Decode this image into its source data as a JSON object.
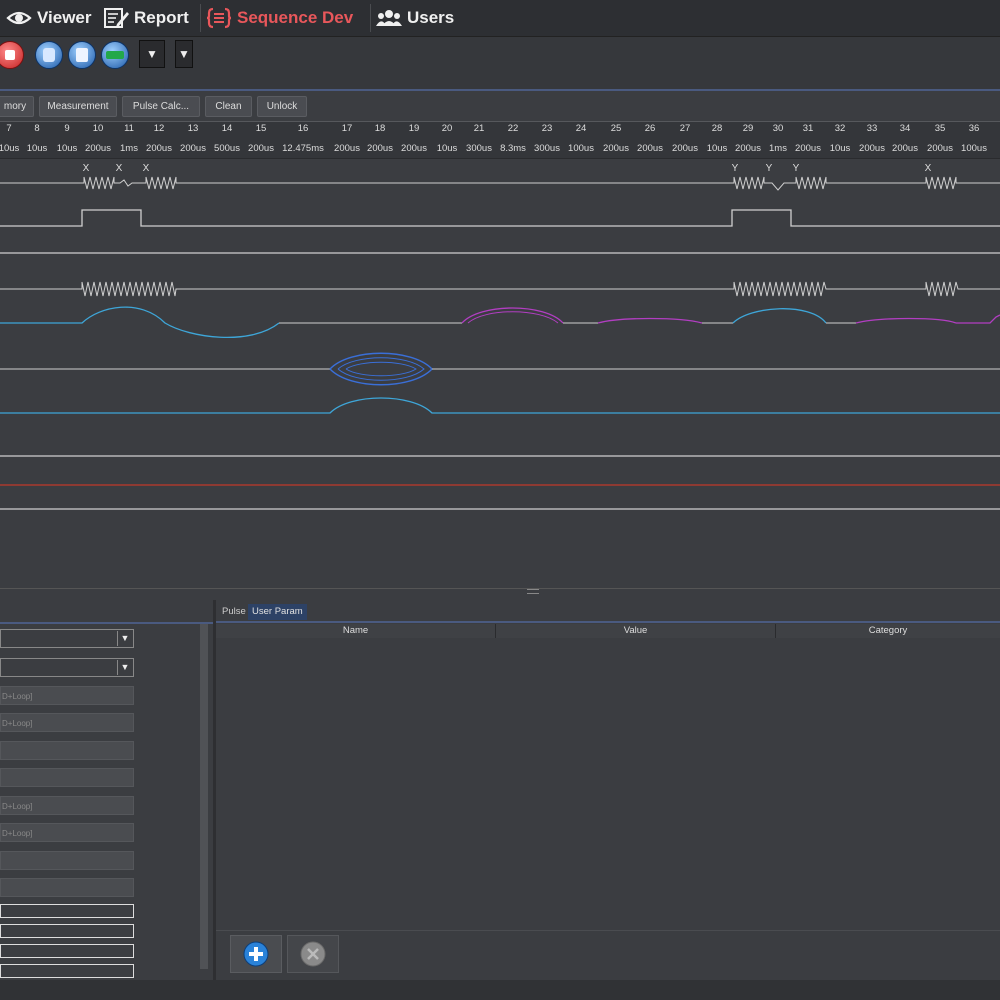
{
  "nav": {
    "viewer": "Viewer",
    "report": "Report",
    "sequence_dev": "Sequence Dev",
    "users": "Users"
  },
  "toolbar": {
    "icons": [
      "stop-icon",
      "database-icon",
      "storage-icon",
      "chart-icon"
    ],
    "dropdown_glyph": "▼"
  },
  "actions": [
    "mory",
    "Measurement",
    "Pulse Calc...",
    "Clean",
    "Unlock"
  ],
  "timeline": {
    "indices": [
      "7",
      "8",
      "9",
      "10",
      "11",
      "12",
      "13",
      "14",
      "15",
      "16",
      "17",
      "18",
      "19",
      "20",
      "21",
      "22",
      "23",
      "24",
      "25",
      "26",
      "27",
      "28",
      "29",
      "30",
      "31",
      "32",
      "33",
      "34",
      "35",
      "36"
    ],
    "durations": [
      "10us",
      "10us",
      "10us",
      "200us",
      "1ms",
      "200us",
      "200us",
      "500us",
      "200us",
      "12.475ms",
      "200us",
      "200us",
      "200us",
      "10us",
      "300us",
      "8.3ms",
      "300us",
      "100us",
      "200us",
      "200us",
      "200us",
      "10us",
      "200us",
      "1ms",
      "200us",
      "10us",
      "200us",
      "200us",
      "200us",
      "100us"
    ],
    "markers": [
      "X",
      "X",
      "X",
      "Y",
      "Y",
      "Y",
      "X"
    ],
    "colors": {
      "rf": "#3ea6d8",
      "purple": "#b23ec2",
      "blue": "#3a6fd8",
      "red": "#c0392b",
      "trace": "#cfcfcf"
    }
  },
  "left_panel": {
    "selects": [
      "▼",
      "▼"
    ],
    "fields": [
      "D+Loop]",
      "D+Loop]",
      "",
      "",
      "D+Loop]",
      "D+Loop]",
      "",
      ""
    ]
  },
  "right_panel": {
    "tabs": [
      "Pulse",
      "User Param"
    ],
    "columns": [
      "Name",
      "Value",
      "Category"
    ],
    "add_icon": "plus-icon",
    "delete_icon": "close-icon"
  }
}
